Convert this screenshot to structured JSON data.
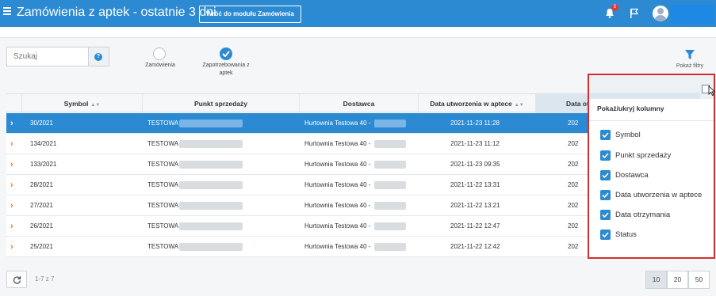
{
  "header": {
    "title": "Zamówienia z aptek - ostatnie 3 dni",
    "back_button": "Wróć do modułu Zamówienia",
    "notification_count": "5"
  },
  "toolbar": {
    "search_placeholder": "Szukaj",
    "help_glyph": "?",
    "radio_1_label": "Zamówienia",
    "radio_2_label": "Zapotrzebowania z aptek",
    "filters_label": "Pokaż filtry"
  },
  "table": {
    "columns": [
      "Symbol",
      "Punkt sprzedaży",
      "Dostawca",
      "Data utworzenia w aptece",
      "Data otr"
    ],
    "rows": [
      {
        "symbol": "30/2021",
        "punkt": "TESTOWA",
        "dostawca": "Hurtownia Testowa 40 -",
        "data": "2021-11-23 11:28",
        "data2": "202"
      },
      {
        "symbol": "134/2021",
        "punkt": "TESTOWA",
        "dostawca": "Hurtownia Testowa 40 -",
        "data": "2021-11-23 11:12",
        "data2": "202"
      },
      {
        "symbol": "133/2021",
        "punkt": "TESTOWA",
        "dostawca": "Hurtownia Testowa 40 -",
        "data": "2021-11-23 09:35",
        "data2": "202"
      },
      {
        "symbol": "28/2021",
        "punkt": "TESTOWA",
        "dostawca": "Hurtownia Testowa 40 -",
        "data": "2021-11-22 13:31",
        "data2": "202"
      },
      {
        "symbol": "27/2021",
        "punkt": "TESTOWA",
        "dostawca": "Hurtownia Testowa 40 -",
        "data": "2021-11-22 13:21",
        "data2": "202"
      },
      {
        "symbol": "26/2021",
        "punkt": "TESTOWA",
        "dostawca": "Hurtownia Testowa 40 -",
        "data": "2021-11-22 12:47",
        "data2": "202"
      },
      {
        "symbol": "25/2021",
        "punkt": "TESTOWA",
        "dostawca": "Hurtownia Testowa 40 -",
        "data": "2021-11-22 12:42",
        "data2": "202"
      }
    ]
  },
  "footer": {
    "count_text": "1-7 z 7",
    "page_sizes": [
      "10",
      "20",
      "50"
    ]
  },
  "column_panel": {
    "title": "Pokaż/ukryj kolumny",
    "options": [
      "Symbol",
      "Punkt sprzedaży",
      "Dostawca",
      "Data utworzenia w aptece",
      "Data otrzymania",
      "Status"
    ]
  },
  "colors": {
    "primary": "#2b8ad2",
    "accent_orange": "#e87a20",
    "highlight_border": "#d32f2f"
  }
}
